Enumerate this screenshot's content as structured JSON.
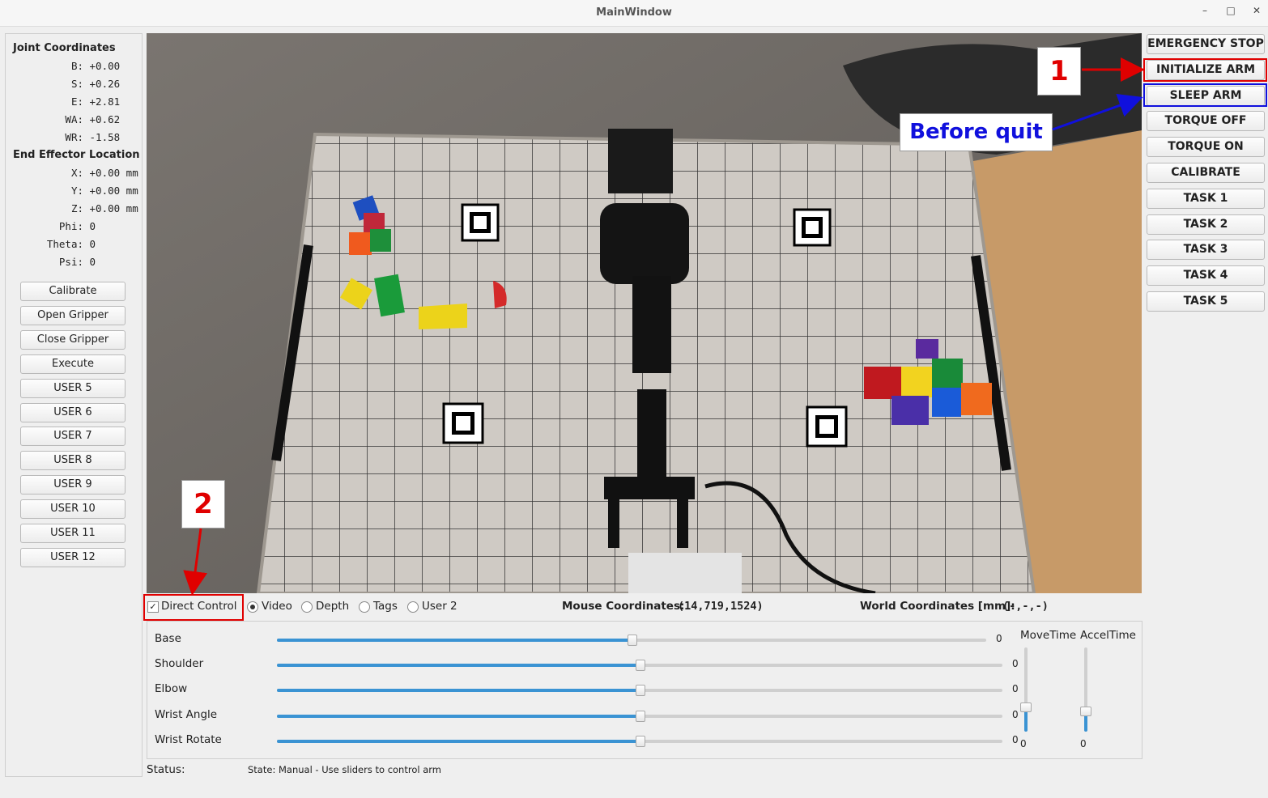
{
  "window": {
    "title": "MainWindow",
    "minimize": "–",
    "maximize": "□",
    "close": "✕"
  },
  "joint": {
    "heading": "Joint Coordinates",
    "rows": [
      {
        "label": "B:",
        "value": "+0.00"
      },
      {
        "label": "S:",
        "value": "+0.26"
      },
      {
        "label": "E:",
        "value": "+2.81"
      },
      {
        "label": "WA:",
        "value": "+0.62"
      },
      {
        "label": "WR:",
        "value": "-1.58"
      }
    ]
  },
  "ee": {
    "heading": "End Effector Location",
    "rows": [
      {
        "label": "X:",
        "value": "+0.00 mm"
      },
      {
        "label": "Y:",
        "value": "+0.00 mm"
      },
      {
        "label": "Z:",
        "value": "+0.00 mm"
      },
      {
        "label": "Phi:",
        "value": "0"
      },
      {
        "label": "Theta:",
        "value": "0"
      },
      {
        "label": "Psi:",
        "value": "0"
      }
    ]
  },
  "left_buttons": [
    "Calibrate",
    "Open Gripper",
    "Close Gripper",
    "Execute",
    "USER 5",
    "USER 6",
    "USER 7",
    "USER 8",
    "USER 9",
    "USER 10",
    "USER 11",
    "USER 12"
  ],
  "right_buttons": [
    "EMERGENCY STOP",
    "INITIALIZE ARM",
    "SLEEP ARM",
    "TORQUE OFF",
    "TORQUE ON",
    "CALIBRATE",
    "TASK 1",
    "TASK 2",
    "TASK 3",
    "TASK 4",
    "TASK 5"
  ],
  "annotations": {
    "one": "1",
    "two": "2",
    "before_quit": "Before quit",
    "red": "#e00000",
    "blue": "#1010dd"
  },
  "view": {
    "direct_control": "Direct Control",
    "direct_control_checked": true,
    "modes": [
      "Video",
      "Depth",
      "Tags",
      "User 2"
    ],
    "selected_mode": "Video",
    "mouse_label": "Mouse Coordinates:",
    "mouse_value": "(14,719,1524)",
    "world_label": "World Coordinates [mm]:",
    "world_value": "(-,-,-)"
  },
  "sliders": [
    {
      "label": "Base",
      "value": "0",
      "fraction": 0.5
    },
    {
      "label": "Shoulder",
      "value": "0",
      "fraction": 0.5
    },
    {
      "label": "Elbow",
      "value": "0",
      "fraction": 0.5
    },
    {
      "label": "Wrist Angle",
      "value": "0",
      "fraction": 0.5
    },
    {
      "label": "Wrist Rotate",
      "value": "0",
      "fraction": 0.5
    }
  ],
  "time_sliders": [
    {
      "label": "MoveTime",
      "value": "0",
      "fraction": 0.3
    },
    {
      "label": "AccelTime",
      "value": "0",
      "fraction": 0.25
    }
  ],
  "status": {
    "label": "Status:",
    "text": "State: Manual - Use sliders to control arm"
  },
  "colors": {
    "accent": "#3a93d3"
  }
}
